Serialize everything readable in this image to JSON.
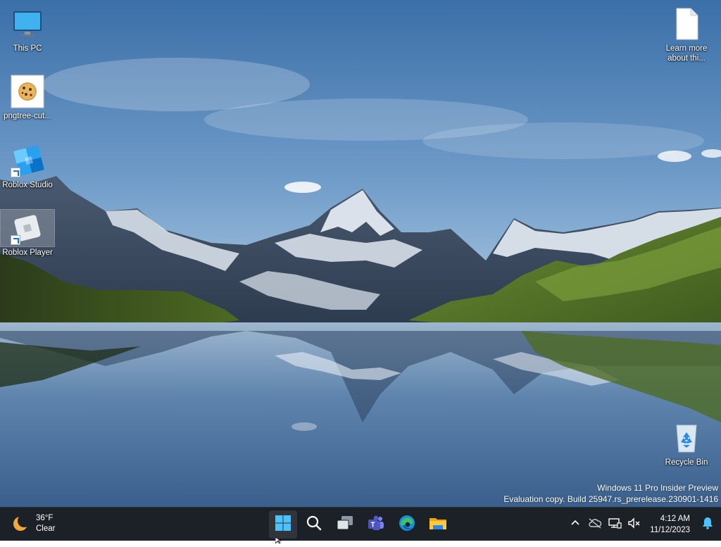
{
  "desktop": {
    "icons": [
      {
        "label": "This PC",
        "icon": "monitor-icon"
      },
      {
        "label": "pngtree-cut...",
        "icon": "cookie-image-icon"
      },
      {
        "label": "Roblox Studio",
        "icon": "roblox-studio-icon"
      },
      {
        "label": "Roblox Player",
        "icon": "roblox-player-icon"
      },
      {
        "label": "Learn more about thi...",
        "label_line1": "Learn more",
        "label_line2": "about thi...",
        "icon": "document-icon"
      },
      {
        "label": "Recycle Bin",
        "icon": "recycle-bin-icon"
      }
    ],
    "watermark": {
      "line1": "Windows 11 Pro Insider Preview",
      "line2": "Evaluation copy. Build 25947.rs_prerelease.230901-1416"
    }
  },
  "taskbar": {
    "weather": {
      "temperature": "36°F",
      "condition": "Clear",
      "icon": "moon-icon"
    },
    "apps": [
      {
        "name": "start",
        "icon": "windows-logo-icon"
      },
      {
        "name": "search",
        "icon": "search-icon"
      },
      {
        "name": "task-view",
        "icon": "task-view-icon"
      },
      {
        "name": "teams",
        "icon": "teams-icon"
      },
      {
        "name": "edge",
        "icon": "edge-icon"
      },
      {
        "name": "file-explorer",
        "icon": "folder-icon"
      }
    ],
    "tray": {
      "icons": [
        "chevron-up-icon",
        "cloud-offline-icon",
        "network-icon",
        "volume-muted-icon"
      ],
      "time": "4:12 AM",
      "date": "11/12/2023",
      "notification_icon": "bell-icon"
    }
  },
  "colors": {
    "taskbar_bg": "#1c2128",
    "accent": "#2b8ae6"
  }
}
